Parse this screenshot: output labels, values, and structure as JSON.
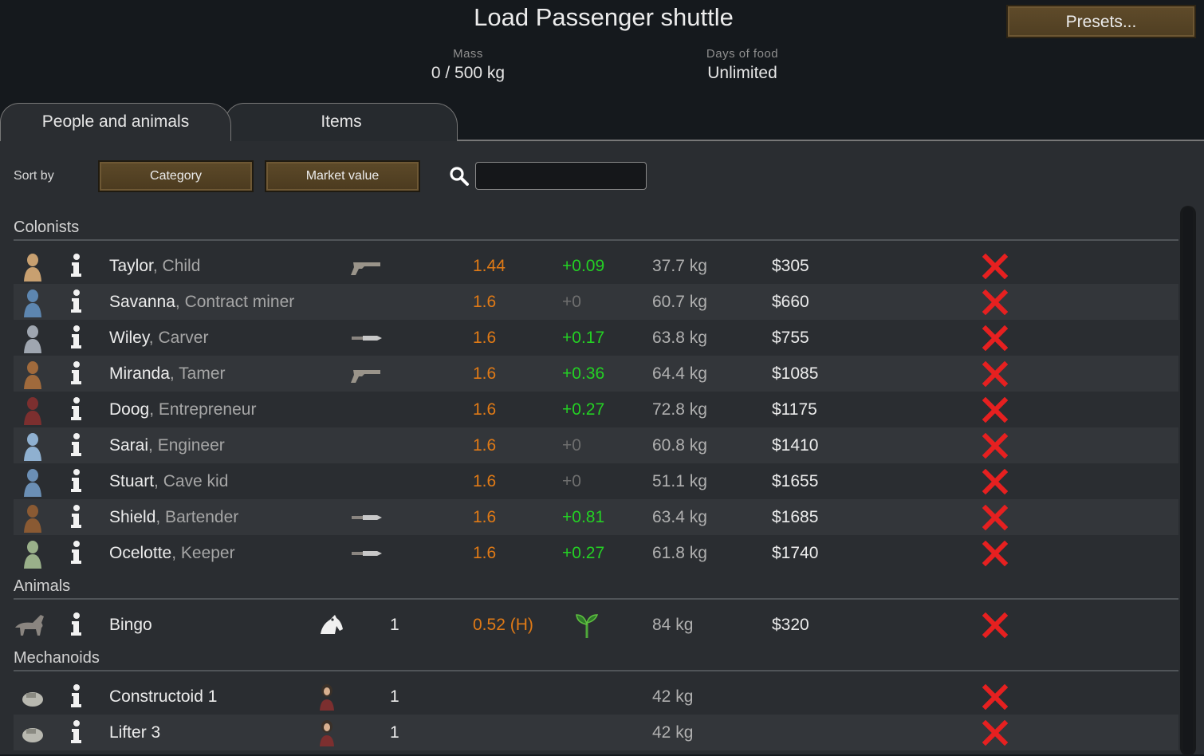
{
  "header": {
    "title": "Load Passenger shuttle",
    "presets_label": "Presets...",
    "mass_label": "Mass",
    "mass_value": "0 / 500 kg",
    "food_label": "Days of food",
    "food_value": "Unlimited"
  },
  "tabs": [
    {
      "label": "People and animals",
      "active": true
    },
    {
      "label": "Items",
      "active": false
    }
  ],
  "sort": {
    "label": "Sort by",
    "primary": "Category",
    "secondary": "Market value"
  },
  "search": {
    "value": "",
    "placeholder": ""
  },
  "sections": {
    "colonists": "Colonists",
    "animals": "Animals",
    "mechanoids": "Mechanoids"
  },
  "colonists": [
    {
      "name": "Taylor",
      "role": ", Child",
      "weapon": "revolver-icon",
      "speed": "1.44",
      "bonus": "+0.09",
      "mass": "37.7 kg",
      "value": "$305"
    },
    {
      "name": "Savanna",
      "role": ", Contract miner",
      "weapon": "",
      "speed": "1.6",
      "bonus": "+0",
      "mass": "60.7 kg",
      "value": "$660"
    },
    {
      "name": "Wiley",
      "role": ", Carver",
      "weapon": "knife-icon",
      "speed": "1.6",
      "bonus": "+0.17",
      "mass": "63.8 kg",
      "value": "$755"
    },
    {
      "name": "Miranda",
      "role": ", Tamer",
      "weapon": "revolver-icon",
      "speed": "1.6",
      "bonus": "+0.36",
      "mass": "64.4 kg",
      "value": "$1085"
    },
    {
      "name": "Doog",
      "role": ", Entrepreneur",
      "weapon": "",
      "speed": "1.6",
      "bonus": "+0.27",
      "mass": "72.8 kg",
      "value": "$1175"
    },
    {
      "name": "Sarai",
      "role": ", Engineer",
      "weapon": "",
      "speed": "1.6",
      "bonus": "+0",
      "mass": "60.8 kg",
      "value": "$1410"
    },
    {
      "name": "Stuart",
      "role": ", Cave kid",
      "weapon": "",
      "speed": "1.6",
      "bonus": "+0",
      "mass": "51.1 kg",
      "value": "$1655"
    },
    {
      "name": "Shield",
      "role": ", Bartender",
      "weapon": "knife-icon",
      "speed": "1.6",
      "bonus": "+0.81",
      "mass": "63.4 kg",
      "value": "$1685"
    },
    {
      "name": "Ocelotte",
      "role": ", Keeper",
      "weapon": "knife-icon",
      "speed": "1.6",
      "bonus": "+0.27",
      "mass": "61.8 kg",
      "value": "$1740"
    }
  ],
  "animals": [
    {
      "name": "Bingo",
      "count": "1",
      "speed": "0.52 (H)",
      "mass": "84 kg",
      "value": "$320"
    }
  ],
  "mechanoids": [
    {
      "name": "Constructoid 1",
      "count": "1",
      "mass": "42 kg"
    },
    {
      "name": "Lifter 3",
      "count": "1",
      "mass": "42 kg"
    }
  ],
  "colors": {
    "speed": "#e07a16",
    "bonus_positive": "#24d024",
    "bonus_zero": "#6e6e6e",
    "remove": "#e62020",
    "button": "#5d4a29"
  }
}
